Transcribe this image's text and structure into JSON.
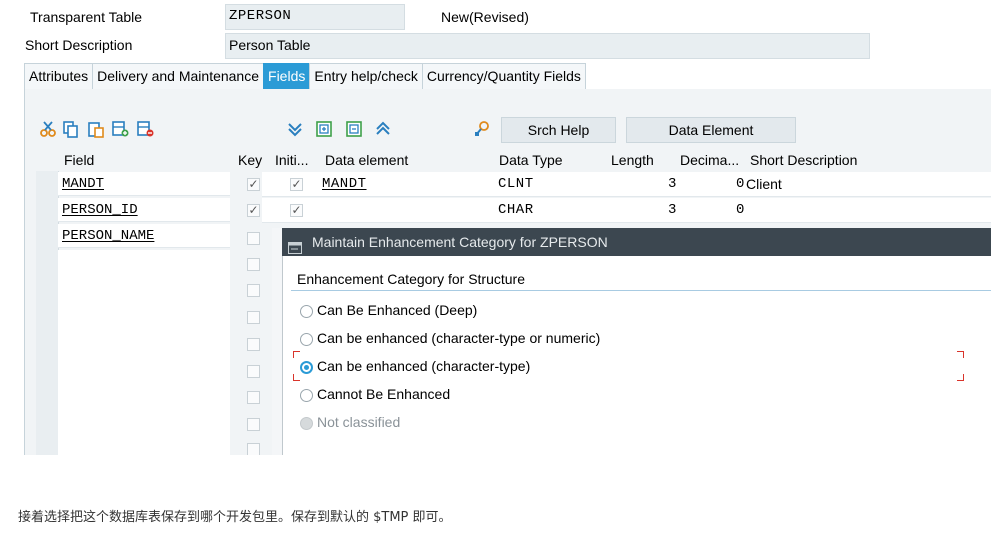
{
  "header": {
    "table_type_label": "Transparent Table",
    "table_name": "ZPERSON",
    "status": "New(Revised)",
    "short_desc_label": "Short Description",
    "short_desc_value": "Person Table"
  },
  "tabs": [
    {
      "label": "Attributes"
    },
    {
      "label": "Delivery and Maintenance"
    },
    {
      "label": "Fields"
    },
    {
      "label": "Entry help/check"
    },
    {
      "label": "Currency/Quantity Fields"
    }
  ],
  "toolbar": {
    "icons": [
      "cut-icon",
      "copy-icon",
      "paste-icon",
      "insert-row-icon",
      "delete-row-icon",
      "sort-down-icon",
      "expand-icon",
      "collapse-icon",
      "sort-up-icon",
      "search-help-icon"
    ],
    "srch_help_label": "Srch Help",
    "data_element_label": "Data Element"
  },
  "columns": {
    "field": "Field",
    "key": "Key",
    "initial": "Initi...",
    "data_element": "Data element",
    "data_type": "Data Type",
    "length": "Length",
    "decimals": "Decima...",
    "short_description": "Short Description"
  },
  "rows": [
    {
      "field": "MANDT",
      "key": true,
      "initial": true,
      "data_element": "MANDT",
      "data_type": "CLNT",
      "length": "3",
      "decimals": "0",
      "short_description": "Client"
    },
    {
      "field": "PERSON_ID",
      "key": true,
      "initial": true,
      "data_element": "",
      "data_type": "CHAR",
      "length": "3",
      "decimals": "0",
      "short_description": ""
    },
    {
      "field": "PERSON_NAME",
      "key": false,
      "initial": false,
      "data_element": "",
      "data_type": "",
      "length": "",
      "decimals": "",
      "short_description": ""
    }
  ],
  "dialog": {
    "title": "Maintain Enhancement Category for ZPERSON",
    "group_title": "Enhancement Category for Structure",
    "options": [
      {
        "label": "Can Be Enhanced (Deep)",
        "selected": false,
        "disabled": false
      },
      {
        "label": "Can be enhanced (character-type or numeric)",
        "selected": false,
        "disabled": false
      },
      {
        "label": "Can be enhanced (character-type)",
        "selected": true,
        "disabled": false
      },
      {
        "label": "Cannot Be Enhanced",
        "selected": false,
        "disabled": false
      },
      {
        "label": "Not classified",
        "selected": false,
        "disabled": true
      }
    ]
  },
  "caption": "接着选择把这个数据库表保存到哪个开发包里。保存到默认的 $TMP 即可。",
  "colors": {
    "accent": "#2b9bd6",
    "dialog_title_bg": "#3c4750",
    "selection_marker": "#d9342b"
  }
}
